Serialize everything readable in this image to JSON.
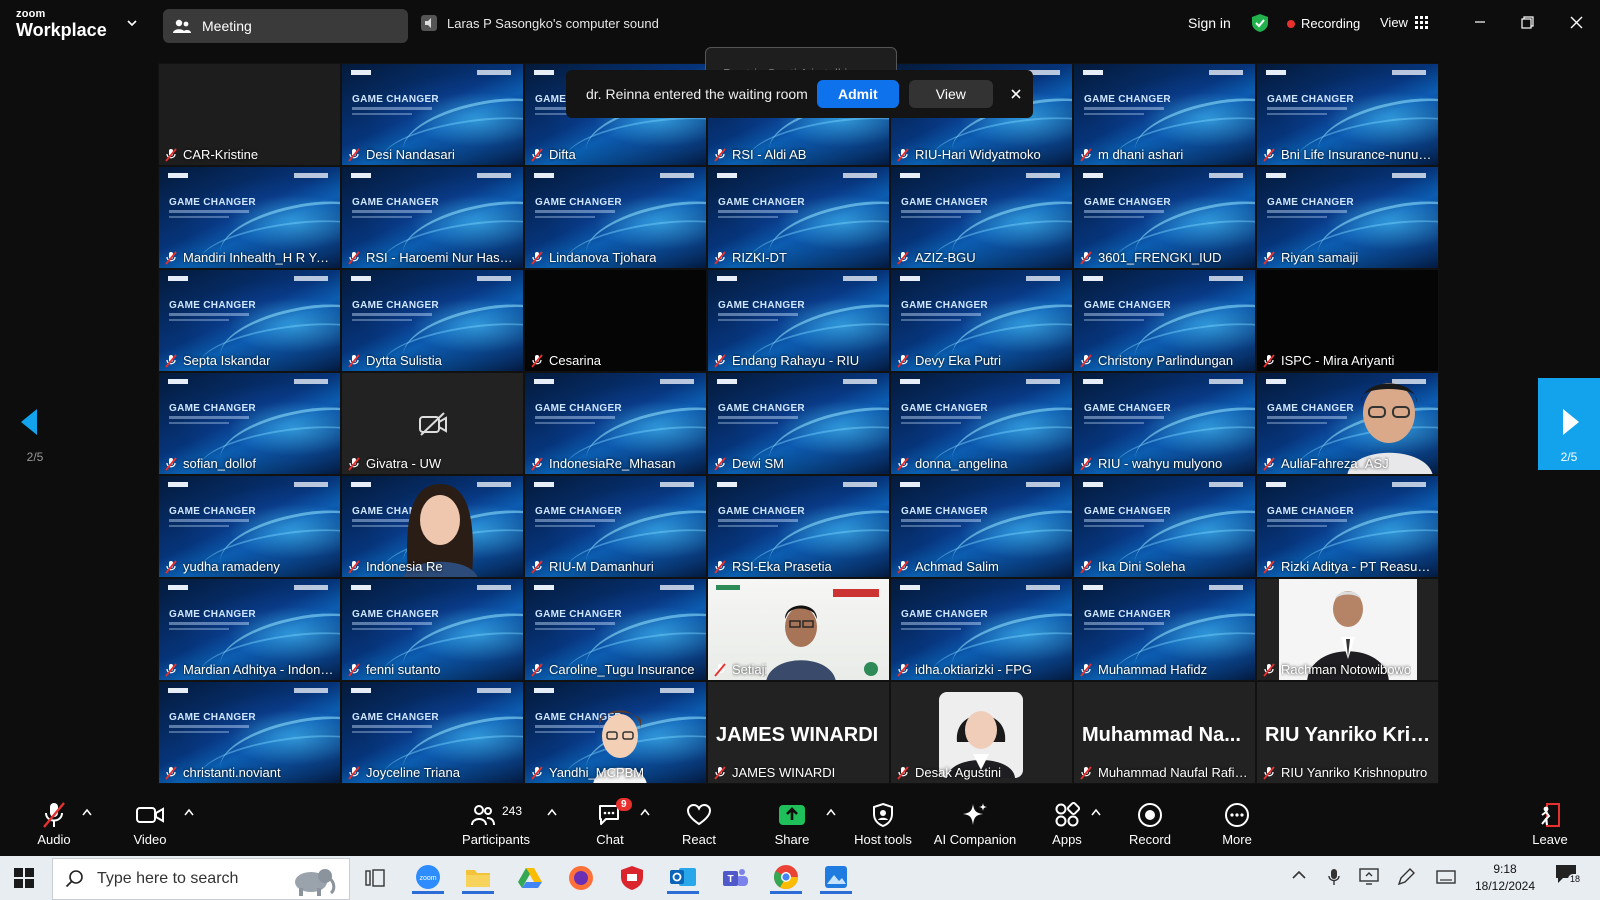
{
  "app": {
    "logo_line1": "zoom",
    "logo_line2": "Workplace",
    "meeting_tab": "Meeting",
    "sound_label": "Laras P Sasongko's computer sound",
    "sign_in": "Sign in",
    "recording": "Recording",
    "view": "View"
  },
  "notifications": {
    "talking": "Beatrix Santi A is talking...",
    "waiting_msg": "dr. Reinna entered the waiting room",
    "admit": "Admit",
    "view": "View",
    "close": "×"
  },
  "pagination": {
    "left": "2/5",
    "right": "2/5"
  },
  "tiles": [
    {
      "name": "CAR-Kristine",
      "bg": "blank"
    },
    {
      "name": "Desi Nandasari",
      "bg": "slide"
    },
    {
      "name": "Difta",
      "bg": "slide"
    },
    {
      "name": "RSI - Aldi AB",
      "bg": "slide"
    },
    {
      "name": "RIU-Hari Widyatmoko",
      "bg": "slide"
    },
    {
      "name": "m dhani ashari",
      "bg": "slide"
    },
    {
      "name": "Bni Life Insurance-nunun...",
      "bg": "slide"
    },
    {
      "name": "Mandiri Inhealth_H R Yosi...",
      "bg": "slide"
    },
    {
      "name": "RSI - Haroemi Nur Hasna...",
      "bg": "slide"
    },
    {
      "name": "Lindanova Tjohara",
      "bg": "slide"
    },
    {
      "name": "RIZKI-DT",
      "bg": "slide"
    },
    {
      "name": "AZIZ-BGU",
      "bg": "slide"
    },
    {
      "name": "3601_FRENGKI_IUD",
      "bg": "slide"
    },
    {
      "name": "Riyan samaiji",
      "bg": "slide"
    },
    {
      "name": "Septa Iskandar",
      "bg": "slide"
    },
    {
      "name": "Dytta Sulistia",
      "bg": "slide"
    },
    {
      "name": "Cesarina",
      "bg": "black"
    },
    {
      "name": "Endang Rahayu - RIU",
      "bg": "slide"
    },
    {
      "name": "Devy Eka Putri",
      "bg": "slide"
    },
    {
      "name": "Christony Parlindungan",
      "bg": "slide"
    },
    {
      "name": "ISPC - Mira Ariyanti",
      "bg": "black"
    },
    {
      "name": "sofian_dollof",
      "bg": "slide"
    },
    {
      "name": "Givatra - UW",
      "bg": "videooff"
    },
    {
      "name": "IndonesiaRe_Mhasan",
      "bg": "slide"
    },
    {
      "name": "Dewi SM",
      "bg": "slide"
    },
    {
      "name": "donna_angelina",
      "bg": "slide"
    },
    {
      "name": "RIU - wahyu mulyono",
      "bg": "slide"
    },
    {
      "name": "AuliaFahreza_ASJ",
      "bg": "slide-person"
    },
    {
      "name": "yudha ramadeny",
      "bg": "slide"
    },
    {
      "name": "Indonesia Re",
      "bg": "slide-person"
    },
    {
      "name": "RIU-M Damanhuri",
      "bg": "slide"
    },
    {
      "name": "RSI-Eka Prasetia",
      "bg": "slide"
    },
    {
      "name": "Achmad Salim",
      "bg": "slide"
    },
    {
      "name": "Ika Dini Soleha",
      "bg": "slide"
    },
    {
      "name": "Rizki Aditya - PT Reasuran...",
      "bg": "slide"
    },
    {
      "name": "Mardian Adhitya - Indone...",
      "bg": "slide"
    },
    {
      "name": "fenni sutanto",
      "bg": "slide"
    },
    {
      "name": "Caroline_Tugu Insurance",
      "bg": "slide"
    },
    {
      "name": "Setiaji",
      "bg": "setiaji"
    },
    {
      "name": "idha.oktiarizki - FPG",
      "bg": "slide"
    },
    {
      "name": "Muhammad Hafidz",
      "bg": "slide"
    },
    {
      "name": "Rachman Notowibowo",
      "bg": "rachman"
    },
    {
      "name": "christanti.noviant",
      "bg": "slide"
    },
    {
      "name": "Joyceline Triana",
      "bg": "slide"
    },
    {
      "name": "Yandhi_MCPBM",
      "bg": "slide-avatar"
    },
    {
      "name": "JAMES WINARDI",
      "bg": "text",
      "big": "JAMES WINARDI"
    },
    {
      "name": "Desak Agustini",
      "bg": "desak"
    },
    {
      "name": "Muhammad Naufal Rafiu...",
      "bg": "text",
      "big": "Muhammad Na..."
    },
    {
      "name": "RIU Yanriko Krishnoputro",
      "bg": "text",
      "big": "RIU Yanriko Kris..."
    }
  ],
  "slide_text": "GAME CHANGER",
  "toolbar": {
    "audio": "Audio",
    "video": "Video",
    "participants": "Participants",
    "participants_count": "243",
    "chat": "Chat",
    "chat_badge": "9",
    "react": "React",
    "share": "Share",
    "host_tools": "Host tools",
    "ai_companion": "AI Companion",
    "apps": "Apps",
    "record": "Record",
    "more": "More",
    "leave": "Leave"
  },
  "taskbar": {
    "search_placeholder": "Type here to search",
    "time": "9:18",
    "date": "18/12/2024",
    "notif_count": "18"
  },
  "colors": {
    "accent": "#0e72ed",
    "recording": "#e8302f",
    "nav": "#12a3ec",
    "share": "#1fbf5a"
  }
}
